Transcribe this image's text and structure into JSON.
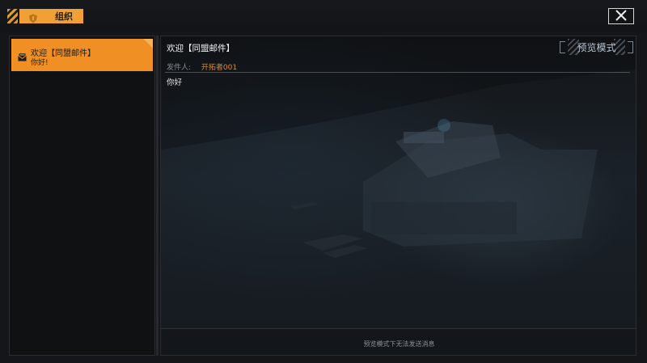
{
  "header": {
    "tab_label": "组织",
    "tab_icon": "shield-icon",
    "close_icon": "close-icon",
    "accent_color": "#f0a034"
  },
  "mail_list": {
    "items": [
      {
        "title": "欢迎【同盟邮件】",
        "preview": "你好!",
        "icon": "mail-icon",
        "selected": true
      }
    ]
  },
  "mail": {
    "subject": "欢迎【同盟邮件】",
    "sender_label": "发件人:",
    "sender_name": "开拓者001",
    "body": "你好",
    "mode_badge": "预览模式",
    "footer_note": "预览模式下无法发送消息"
  }
}
